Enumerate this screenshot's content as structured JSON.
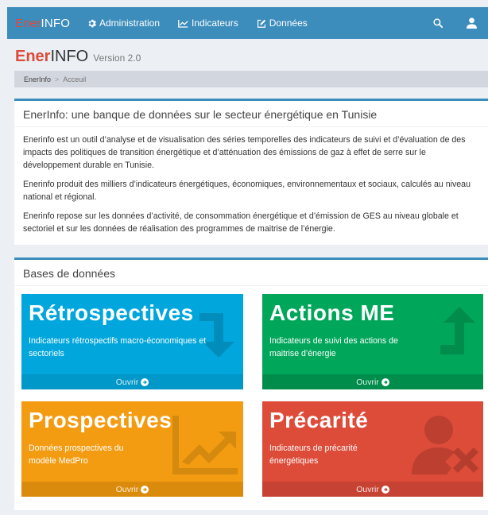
{
  "navbar": {
    "brand_part1": "Ener",
    "brand_part2": "INFO",
    "items": [
      {
        "label": "Administration",
        "icon": "gear-icon"
      },
      {
        "label": "Indicateurs",
        "icon": "line-chart-icon"
      },
      {
        "label": "Données",
        "icon": "edit-icon"
      }
    ],
    "search_icon": "search-icon",
    "user_icon": "user-icon"
  },
  "header": {
    "title_part1": "Ener",
    "title_part2": "INFO",
    "version": "Version 2.0"
  },
  "breadcrumb": {
    "home": "EnerInfo",
    "separator": ">",
    "current": "Acceuil"
  },
  "intro": {
    "title": "EnerInfo: une banque de données sur le secteur énergétique en Tunisie",
    "paragraphs": [
      "Enerinfo est un outil d’analyse et de visualisation des séries temporelles des indicateurs de suivi et d’évaluation de des impacts des politiques de transition énergétique et d’atténuation des émissions de gaz à effet de serre sur le développement durable en Tunisie.",
      "Enerinfo produit des milliers d’indicateurs énergétiques, économiques, environnementaux et sociaux, calculés au niveau national et régional.",
      "Enerinfo repose sur les données d’activité, de consommation énergétique et d’émission de GES au niveau globale et sectoriel et sur les données de réalisation des programmes de maitrise de l’énergie."
    ]
  },
  "databases": {
    "title": "Bases de données",
    "tiles": [
      {
        "title": "Rétrospectives",
        "desc": "Indicateurs rétrospectifs macro-économiques et sectoriels",
        "link": "Ouvrir",
        "icon": "level-down-arrow-icon"
      },
      {
        "title": "Actions ME",
        "desc": "Indicateurs de suivi des actions de maitrise d’énergie",
        "link": "Ouvrir",
        "icon": "level-up-arrow-icon"
      },
      {
        "title": "Prospectives",
        "desc": "Données prospectives du modèle MedPro",
        "link": "Ouvrir",
        "icon": "area-chart-icon"
      },
      {
        "title": "Précarité",
        "desc": "Indicateurs de précarité énergétiques",
        "link": "Ouvrir",
        "icon": "user-remove-icon"
      }
    ]
  },
  "colors": {
    "primary": "#3c8dbc",
    "brand_red": "#dd4b39",
    "tile_blue": "#00a6dc",
    "tile_green": "#00a65a",
    "tile_orange": "#f39c12",
    "tile_red": "#dd4b39"
  }
}
